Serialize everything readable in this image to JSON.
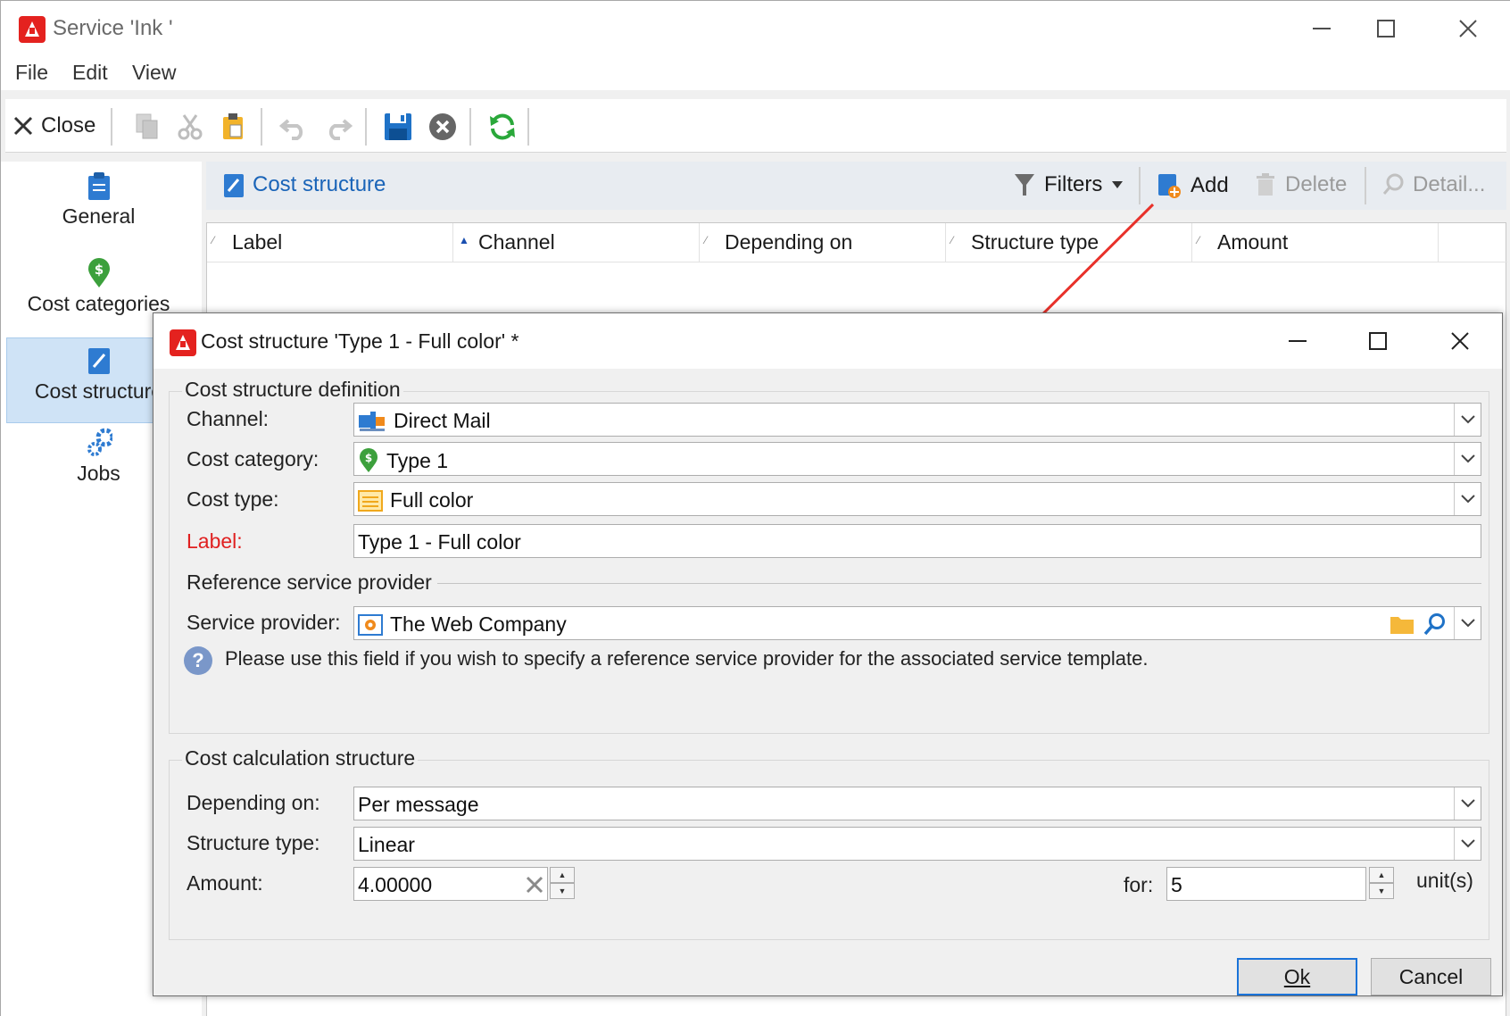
{
  "window": {
    "title": "Service 'Ink '"
  },
  "menu": [
    "File",
    "Edit",
    "View"
  ],
  "toolbar": {
    "close_label": "Close"
  },
  "sidebar": {
    "items": [
      {
        "label": "General",
        "icon": "clipboard-icon"
      },
      {
        "label": "Cost categories",
        "icon": "money-pin-icon"
      },
      {
        "label": "Cost structure",
        "icon": "pencil-doc-icon",
        "active": true
      },
      {
        "label": "Jobs",
        "icon": "gears-icon"
      }
    ]
  },
  "section": {
    "title": "Cost structure",
    "filters_label": "Filters",
    "add_label": "Add",
    "delete_label": "Delete",
    "detail_label": "Detail..."
  },
  "grid": {
    "columns": [
      "Label",
      "Channel",
      "Depending on",
      "Structure type",
      "Amount"
    ]
  },
  "dialog": {
    "title": "Cost structure 'Type 1 - Full color' *",
    "definition_group": "Cost structure definition",
    "channel_label": "Channel:",
    "channel_value": "Direct Mail",
    "cost_category_label": "Cost category:",
    "cost_category_value": "Type 1",
    "cost_type_label": "Cost type:",
    "cost_type_value": "Full color",
    "label_label": "Label:",
    "label_value": "Type 1 - Full color",
    "reference_heading": "Reference service provider",
    "provider_label": "Service provider:",
    "provider_value": "The Web Company",
    "help_text": "Please use this field if you wish to specify a reference service provider for the associated service template.",
    "calc_group": "Cost calculation structure",
    "depending_label": "Depending on:",
    "depending_value": "Per message",
    "structure_type_label": "Structure type:",
    "structure_type_value": "Linear",
    "amount_label": "Amount:",
    "amount_value": "4.00000",
    "for_label": "for:",
    "for_value": "5",
    "units_label": "unit(s)",
    "ok_label": "Ok",
    "cancel_label": "Cancel"
  },
  "colors": {
    "accent": "#1a64b8",
    "required": "#e02020",
    "arrow": "#e8312a",
    "brand": "#e4221f"
  }
}
